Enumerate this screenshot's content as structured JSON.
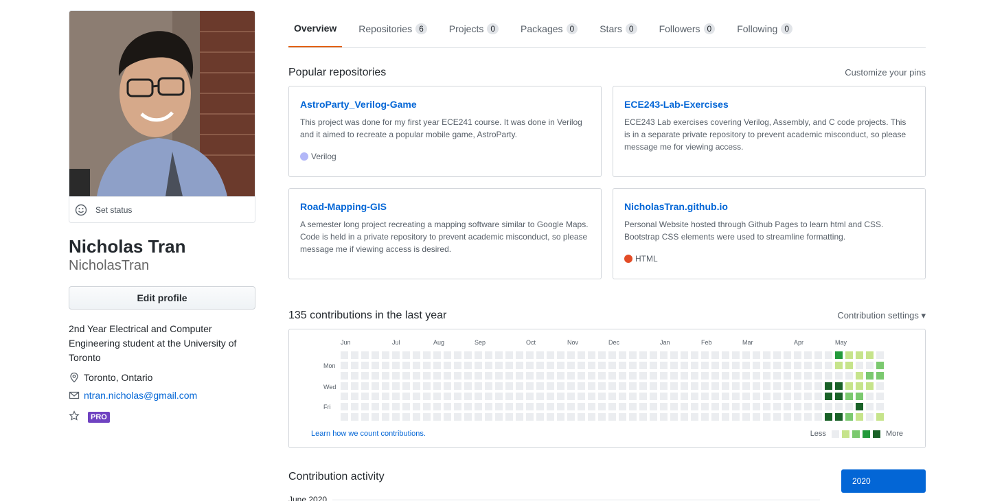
{
  "profile": {
    "set_status": "Set status",
    "full_name": "Nicholas Tran",
    "username": "NicholasTran",
    "edit_profile": "Edit profile",
    "bio": "2nd Year Electrical and Computer Engineering student at the University of Toronto",
    "location": "Toronto, Ontario",
    "email": "ntran.nicholas@gmail.com",
    "pro_badge": "PRO"
  },
  "tabs": [
    {
      "label": "Overview",
      "count": null,
      "active": true
    },
    {
      "label": "Repositories",
      "count": "6"
    },
    {
      "label": "Projects",
      "count": "0"
    },
    {
      "label": "Packages",
      "count": "0"
    },
    {
      "label": "Stars",
      "count": "0"
    },
    {
      "label": "Followers",
      "count": "0"
    },
    {
      "label": "Following",
      "count": "0"
    }
  ],
  "popular": {
    "title": "Popular repositories",
    "customize": "Customize your pins",
    "repos": [
      {
        "name": "AstroParty_Verilog-Game",
        "description": "This project was done for my first year ECE241 course. It was done in Verilog and it aimed to recreate a popular mobile game, AstroParty.",
        "language": "Verilog",
        "lang_color": "#b2b7f8"
      },
      {
        "name": "ECE243-Lab-Exercises",
        "description": "ECE243 Lab exercises covering Verilog, Assembly, and C code projects. This is in a separate private repository to prevent academic misconduct, so please message me for viewing access.",
        "language": "",
        "lang_color": ""
      },
      {
        "name": "Road-Mapping-GIS",
        "description": "A semester long project recreating a mapping software similar to Google Maps. Code is held in a private repository to prevent academic misconduct, so please message me if viewing access is desired.",
        "language": "",
        "lang_color": ""
      },
      {
        "name": "NicholasTran.github.io",
        "description": "Personal Website hosted through Github Pages to learn html and CSS. Bootstrap CSS elements were used to streamline formatting.",
        "language": "HTML",
        "lang_color": "#e34c26"
      }
    ]
  },
  "contributions": {
    "title": "135 contributions in the last year",
    "settings": "Contribution settings ▾",
    "months": [
      "Jun",
      "Jul",
      "Aug",
      "Sep",
      "Oct",
      "Nov",
      "Dec",
      "Jan",
      "Feb",
      "Mar",
      "Apr",
      "May"
    ],
    "days": [
      "Mon",
      "Wed",
      "Fri"
    ],
    "learn": "Learn how we count contributions.",
    "less": "Less",
    "more": "More",
    "colors": [
      "#ebedf0",
      "#c6e48b",
      "#7bc96f",
      "#239a3b",
      "#196127"
    ],
    "active_levels": [
      [
        0,
        0,
        0,
        0,
        0,
        0,
        0
      ],
      [
        0,
        0,
        0,
        4,
        4,
        0,
        4
      ],
      [
        3,
        1,
        0,
        4,
        4,
        0,
        4
      ],
      [
        1,
        1,
        0,
        1,
        2,
        0,
        2
      ],
      [
        1,
        0,
        1,
        1,
        2,
        4,
        1
      ],
      [
        1,
        0,
        2,
        1,
        0,
        0,
        0
      ],
      [
        0,
        2,
        2,
        0,
        0,
        0,
        1
      ]
    ]
  },
  "activity": {
    "title": "Contribution activity",
    "year_button": "2020",
    "timeline_label": "June 2020"
  }
}
